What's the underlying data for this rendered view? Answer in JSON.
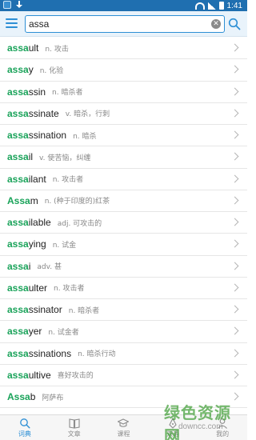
{
  "status_bar": {
    "time": "1:41"
  },
  "search": {
    "value": "assa",
    "placeholder": ""
  },
  "colors": {
    "accent": "#2d8fd5",
    "highlight": "#1aa35a",
    "status_bar": "#1f6fb0"
  },
  "results": [
    {
      "prefix": "assa",
      "rest": "ult",
      "definition": "n. 攻击"
    },
    {
      "prefix": "assa",
      "rest": "y",
      "definition": "n. 化验"
    },
    {
      "prefix": "assa",
      "rest": "ssin",
      "definition": "n. 暗杀者"
    },
    {
      "prefix": "assa",
      "rest": "ssinate",
      "definition": "v. 暗杀，行刺"
    },
    {
      "prefix": "assa",
      "rest": "ssination",
      "definition": "n. 暗杀"
    },
    {
      "prefix": "assa",
      "rest": "il",
      "definition": "v. 使苦恼，纠缠"
    },
    {
      "prefix": "assa",
      "rest": "ilant",
      "definition": "n. 攻击者"
    },
    {
      "prefix": "Assa",
      "rest": "m",
      "definition": "n. (种于印度的)红茶"
    },
    {
      "prefix": "assa",
      "rest": "ilable",
      "definition": "adj. 可攻击的"
    },
    {
      "prefix": "assa",
      "rest": "ying",
      "definition": "n. 试金"
    },
    {
      "prefix": "assa",
      "rest": "i",
      "definition": "adv. 甚"
    },
    {
      "prefix": "assa",
      "rest": "ulter",
      "definition": "n. 攻击者"
    },
    {
      "prefix": "assa",
      "rest": "ssinator",
      "definition": "n. 暗杀者"
    },
    {
      "prefix": "assa",
      "rest": "yer",
      "definition": "n. 试金者"
    },
    {
      "prefix": "assa",
      "rest": "ssinations",
      "definition": "n. 暗杀行动"
    },
    {
      "prefix": "assa",
      "rest": "ultive",
      "definition": "喜好攻击的"
    },
    {
      "prefix": "Assa",
      "rest": "b",
      "definition": "阿萨布"
    }
  ],
  "bottom_nav": [
    {
      "label": "词典",
      "icon": "search-icon",
      "active": true
    },
    {
      "label": "文章",
      "icon": "book-icon",
      "active": false
    },
    {
      "label": "课程",
      "icon": "graduation-cap-icon",
      "active": false
    },
    {
      "label": "双语",
      "icon": "pen-icon",
      "active": false
    },
    {
      "label": "我的",
      "icon": "user-icon",
      "active": false
    }
  ],
  "watermark": {
    "title": "绿色资源网",
    "url": "downcc.com"
  }
}
